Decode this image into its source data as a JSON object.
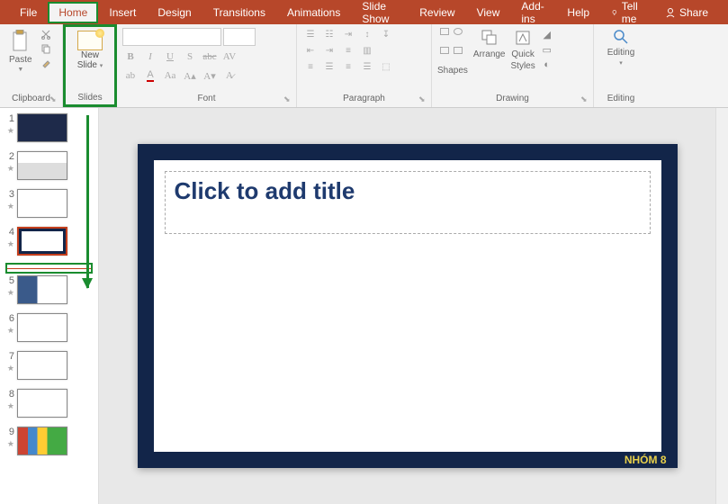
{
  "tabs": {
    "file": "File",
    "home": "Home",
    "insert": "Insert",
    "design": "Design",
    "transitions": "Transitions",
    "animations": "Animations",
    "slideshow": "Slide Show",
    "review": "Review",
    "view": "View",
    "addins": "Add-ins",
    "help": "Help",
    "tellme": "Tell me",
    "share": "Share"
  },
  "ribbon": {
    "clipboard": {
      "label": "Clipboard",
      "paste": "Paste"
    },
    "slides": {
      "label": "Slides",
      "newslide1": "New",
      "newslide2": "Slide"
    },
    "font": {
      "label": "Font"
    },
    "paragraph": {
      "label": "Paragraph"
    },
    "drawing": {
      "label": "Drawing",
      "shapes": "Shapes",
      "arrange": "Arrange",
      "quick": "Quick",
      "styles": "Styles"
    },
    "editing": {
      "label": "Editing",
      "btn": "Editing"
    }
  },
  "thumbs": [
    "1",
    "2",
    "3",
    "4",
    "5",
    "6",
    "7",
    "8",
    "9"
  ],
  "slide": {
    "title_placeholder": "Click to add title",
    "footer": "NHÓM 8"
  }
}
